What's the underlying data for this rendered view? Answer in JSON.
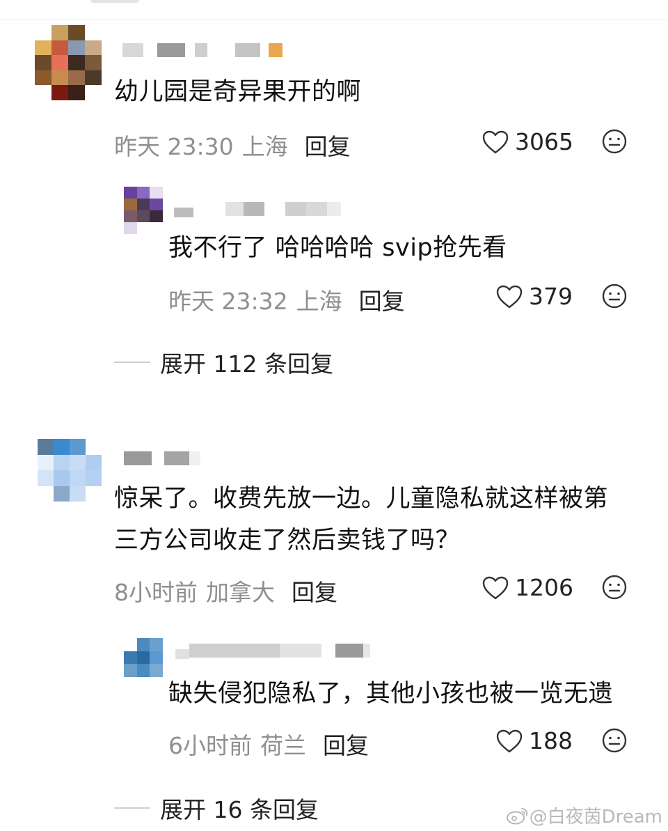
{
  "comments": [
    {
      "text": "幼儿园是奇异果开的啊",
      "time": "昨天 23:30",
      "location": "上海",
      "reply_label": "回复",
      "likes": "3065"
    },
    {
      "text": "我不行了 哈哈哈哈 svip抢先看",
      "time": "昨天 23:32",
      "location": "上海",
      "reply_label": "回复",
      "likes": "379"
    },
    {
      "text_line1": "惊呆了。收费先放一边。儿童隐私就这样被第",
      "text_line2": "三方公司收走了然后卖钱了吗？",
      "time": "8小时前",
      "location": "加拿大",
      "reply_label": "回复",
      "likes": "1206"
    },
    {
      "text": "缺失侵犯隐私了，其他小孩也被一览无遗",
      "time": "6小时前",
      "location": "荷兰",
      "reply_label": "回复",
      "likes": "188"
    }
  ],
  "expand_replies": [
    "展开 112 条回复",
    "展开 16 条回复"
  ],
  "watermark": "@白夜茵Dream",
  "icons": {
    "like": "heart-outline-icon",
    "emoji": "emoji-face-icon",
    "weibo": "weibo-logo-icon"
  },
  "colors": {
    "meta_text": "#8f8f8f",
    "body_text": "#111111"
  }
}
